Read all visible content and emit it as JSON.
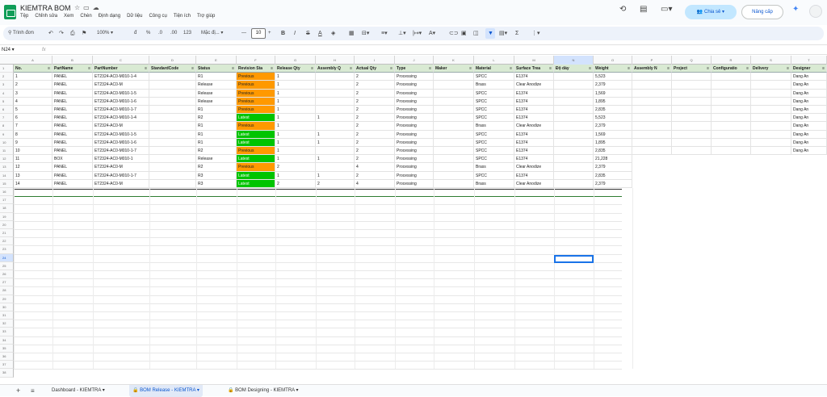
{
  "app": {
    "title": "KIEMTRA BOM",
    "menus": [
      "Tệp",
      "Chỉnh sửa",
      "Xem",
      "Chèn",
      "Định dạng",
      "Dữ liệu",
      "Công cụ",
      "Tiện ích",
      "Trợ giúp"
    ],
    "share_label": "Chia sẻ",
    "upgrade_label": "Nâng cấp"
  },
  "toolbar": {
    "search_label": "Trình đơn",
    "zoom": "100%",
    "currency": "đ",
    "percent": "%",
    "dec_less": ".0",
    ".dec_more": ".00",
    "dec_more": ".00",
    "format_123": "123",
    "font": "Mặc đị...",
    "font_size": "10"
  },
  "formula_bar": {
    "name_box": "N24",
    "fx": "fx",
    "value": ""
  },
  "column_letters": [
    "A",
    "B",
    "C",
    "D",
    "E",
    "F",
    "G",
    "H",
    "I",
    "J",
    "K",
    "L",
    "M",
    "N",
    "O",
    "P",
    "Q",
    "R",
    "S",
    "T"
  ],
  "headers": [
    "No.",
    "PartName",
    "PartNumber",
    "StandardCode",
    "Status",
    "Revision Sta",
    "Release Qty",
    "Assembly Q",
    "Actual Qty",
    "Type",
    "Maker",
    "Material",
    "Surface Trea",
    "Độ dày",
    "Weight",
    "Assembly N",
    "Project",
    "Configuratio",
    "Delivery",
    "Designer"
  ],
  "rows": [
    [
      "1",
      "PANEL",
      "ET2324-AC0-M010-1-4",
      "",
      "R1",
      "Previous",
      "1",
      "",
      "2",
      "Processing",
      "",
      "SPCC",
      "E1374",
      "",
      "5,523",
      "",
      "",
      "",
      "",
      "Dang An"
    ],
    [
      "2",
      "PANEL",
      "ET2324-AC0-M",
      "",
      "Release",
      "Previous",
      "1",
      "",
      "2",
      "Processing",
      "",
      "Brass",
      "Clear Anodize",
      "",
      "2,379",
      "",
      "",
      "",
      "",
      "Dang An"
    ],
    [
      "3",
      "PANEL",
      "ET2324-AC0-M010-1-5",
      "",
      "Release",
      "Previous",
      "1",
      "",
      "2",
      "Processing",
      "",
      "SPCC",
      "E1374",
      "",
      "1,569",
      "",
      "",
      "",
      "",
      "Dang An"
    ],
    [
      "4",
      "PANEL",
      "ET2324-AC0-M010-1-6",
      "",
      "Release",
      "Previous",
      "1",
      "",
      "2",
      "Processing",
      "",
      "SPCC",
      "E1374",
      "",
      "1,895",
      "",
      "",
      "",
      "",
      "Dang An"
    ],
    [
      "5",
      "PANEL",
      "ET2324-AC0-M010-1-7",
      "",
      "R1",
      "Previous",
      "1",
      "",
      "2",
      "Processing",
      "",
      "SPCC",
      "E1374",
      "",
      "2,835",
      "",
      "",
      "",
      "",
      "Dang An"
    ],
    [
      "6",
      "PANEL",
      "ET2324-AC0-M010-1-4",
      "",
      "R2",
      "Latest",
      "1",
      "1",
      "2",
      "Processing",
      "",
      "SPCC",
      "E1374",
      "",
      "5,523",
      "",
      "",
      "",
      "",
      "Dang An"
    ],
    [
      "7",
      "PANEL",
      "ET2324-AC0-M",
      "",
      "R1",
      "Previous",
      "1",
      "",
      "2",
      "Processing",
      "",
      "Brass",
      "Clear Anodize",
      "",
      "2,379",
      "",
      "",
      "",
      "",
      "Dang An"
    ],
    [
      "8",
      "PANEL",
      "ET2324-AC0-M010-1-5",
      "",
      "R1",
      "Latest",
      "1",
      "1",
      "2",
      "Processing",
      "",
      "SPCC",
      "E1374",
      "",
      "1,569",
      "",
      "",
      "",
      "",
      "Dang An"
    ],
    [
      "9",
      "PANEL",
      "ET2324-AC0-M010-1-6",
      "",
      "R1",
      "Latest",
      "1",
      "1",
      "2",
      "Processing",
      "",
      "SPCC",
      "E1374",
      "",
      "1,895",
      "",
      "",
      "",
      "",
      "Dang An"
    ],
    [
      "10",
      "PANEL",
      "ET2324-AC0-M010-1-7",
      "",
      "R2",
      "Previous",
      "1",
      "",
      "2",
      "Processing",
      "",
      "SPCC",
      "E1374",
      "",
      "2,835",
      "",
      "",
      "",
      "",
      "Dang An"
    ],
    [
      "11",
      "BOX",
      "ET2324-AC0-M010-1",
      "",
      "Release",
      "Latest",
      "1",
      "1",
      "2",
      "Processing",
      "",
      "SPCC",
      "E1374",
      "",
      "21,228",
      "",
      "",
      "",
      "",
      ""
    ],
    [
      "12",
      "PANEL",
      "ET2324-AC0-M",
      "",
      "R2",
      "Previous",
      "2",
      "",
      "4",
      "Processing",
      "",
      "Brass",
      "Clear Anodize",
      "",
      "2,379",
      "",
      "",
      "",
      "",
      ""
    ],
    [
      "13",
      "PANEL",
      "ET2324-AC0-M010-1-7",
      "",
      "R3",
      "Latest",
      "1",
      "1",
      "2",
      "Processing",
      "",
      "SPCC",
      "E1374",
      "",
      "2,835",
      "",
      "",
      "",
      "",
      ""
    ],
    [
      "14",
      "PANEL",
      "ET2324-AC0-M",
      "",
      "R3",
      "Latest",
      "2",
      "2",
      "4",
      "Processing",
      "",
      "Brass",
      "Clear Anodize",
      "",
      "2,379",
      "",
      "",
      "",
      "",
      ""
    ]
  ],
  "row_numbers": [
    "1",
    "2",
    "3",
    "4",
    "5",
    "6",
    "7",
    "8",
    "9",
    "10",
    "11",
    "12",
    "13",
    "14",
    "15",
    "16",
    "17",
    "18",
    "19",
    "20",
    "21",
    "22",
    "23",
    "24",
    "25",
    "26",
    "27",
    "28",
    "29",
    "30",
    "31",
    "32",
    "33",
    "34",
    "35",
    "36",
    "37",
    "38"
  ],
  "sheet_tabs": [
    {
      "label": "Dashboard - KIEMTRA",
      "active": false,
      "locked": false
    },
    {
      "label": "BOM Release - KIEMTRA",
      "active": true,
      "locked": true
    },
    {
      "label": "BOM Designing - KIEMTRA",
      "active": false,
      "locked": true
    }
  ],
  "colors": {
    "previous": "#ff9900",
    "latest": "#00c400",
    "header_fill": "#d9ead3",
    "accent": "#0b57d0"
  }
}
